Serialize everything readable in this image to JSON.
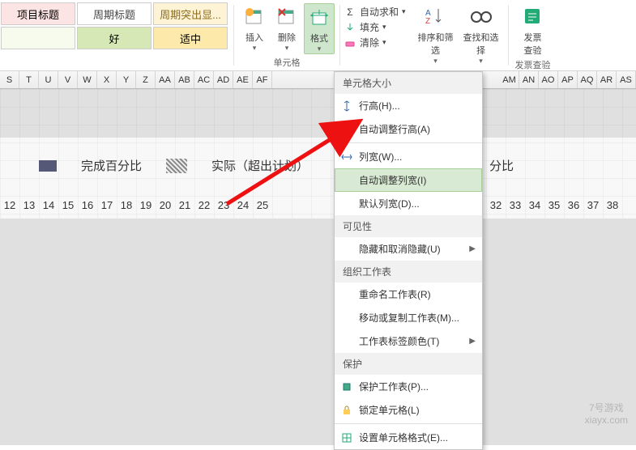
{
  "styles": {
    "row1": [
      "项目标题",
      "周期标题",
      "周期突出显..."
    ],
    "row2": [
      "",
      "好",
      "适中"
    ]
  },
  "ribbon": {
    "insert": "插入",
    "delete": "删除",
    "format": "格式",
    "cells_group": "单元格",
    "autosum": "自动求和",
    "fill": "填充",
    "clear": "清除",
    "sort": "排序和筛选",
    "find": "查找和选择",
    "invoice": "发票\n查验",
    "invoice_group": "发票查验"
  },
  "columns1": [
    "S",
    "T",
    "U",
    "V",
    "W",
    "X",
    "Y",
    "Z",
    "AA",
    "AB",
    "AC",
    "AD",
    "AE",
    "AF"
  ],
  "columns2": [
    "AM",
    "AN",
    "AO",
    "AP",
    "AQ",
    "AR",
    "AS"
  ],
  "legend": {
    "l1": "完成百分比",
    "l2": "实际（超出计划）",
    "r1": "分比"
  },
  "numbers1": [
    12,
    13,
    14,
    15,
    16,
    17,
    18,
    19,
    20,
    21,
    22,
    23,
    24,
    25
  ],
  "numbers2": [
    32,
    33,
    34,
    35,
    36,
    37,
    38
  ],
  "menu": {
    "h1": "单元格大小",
    "row_height": "行高(H)...",
    "autofit_row": "自动调整行高(A)",
    "col_width": "列宽(W)...",
    "autofit_col": "自动调整列宽(I)",
    "default_width": "默认列宽(D)...",
    "h2": "可见性",
    "hide": "隐藏和取消隐藏(U)",
    "h3": "组织工作表",
    "rename": "重命名工作表(R)",
    "move": "移动或复制工作表(M)...",
    "tabcolor": "工作表标签颜色(T)",
    "h4": "保护",
    "protect": "保护工作表(P)...",
    "lock": "锁定单元格(L)",
    "formatcells": "设置单元格格式(E)..."
  },
  "watermark": "7号游戏\nxiayx.com"
}
